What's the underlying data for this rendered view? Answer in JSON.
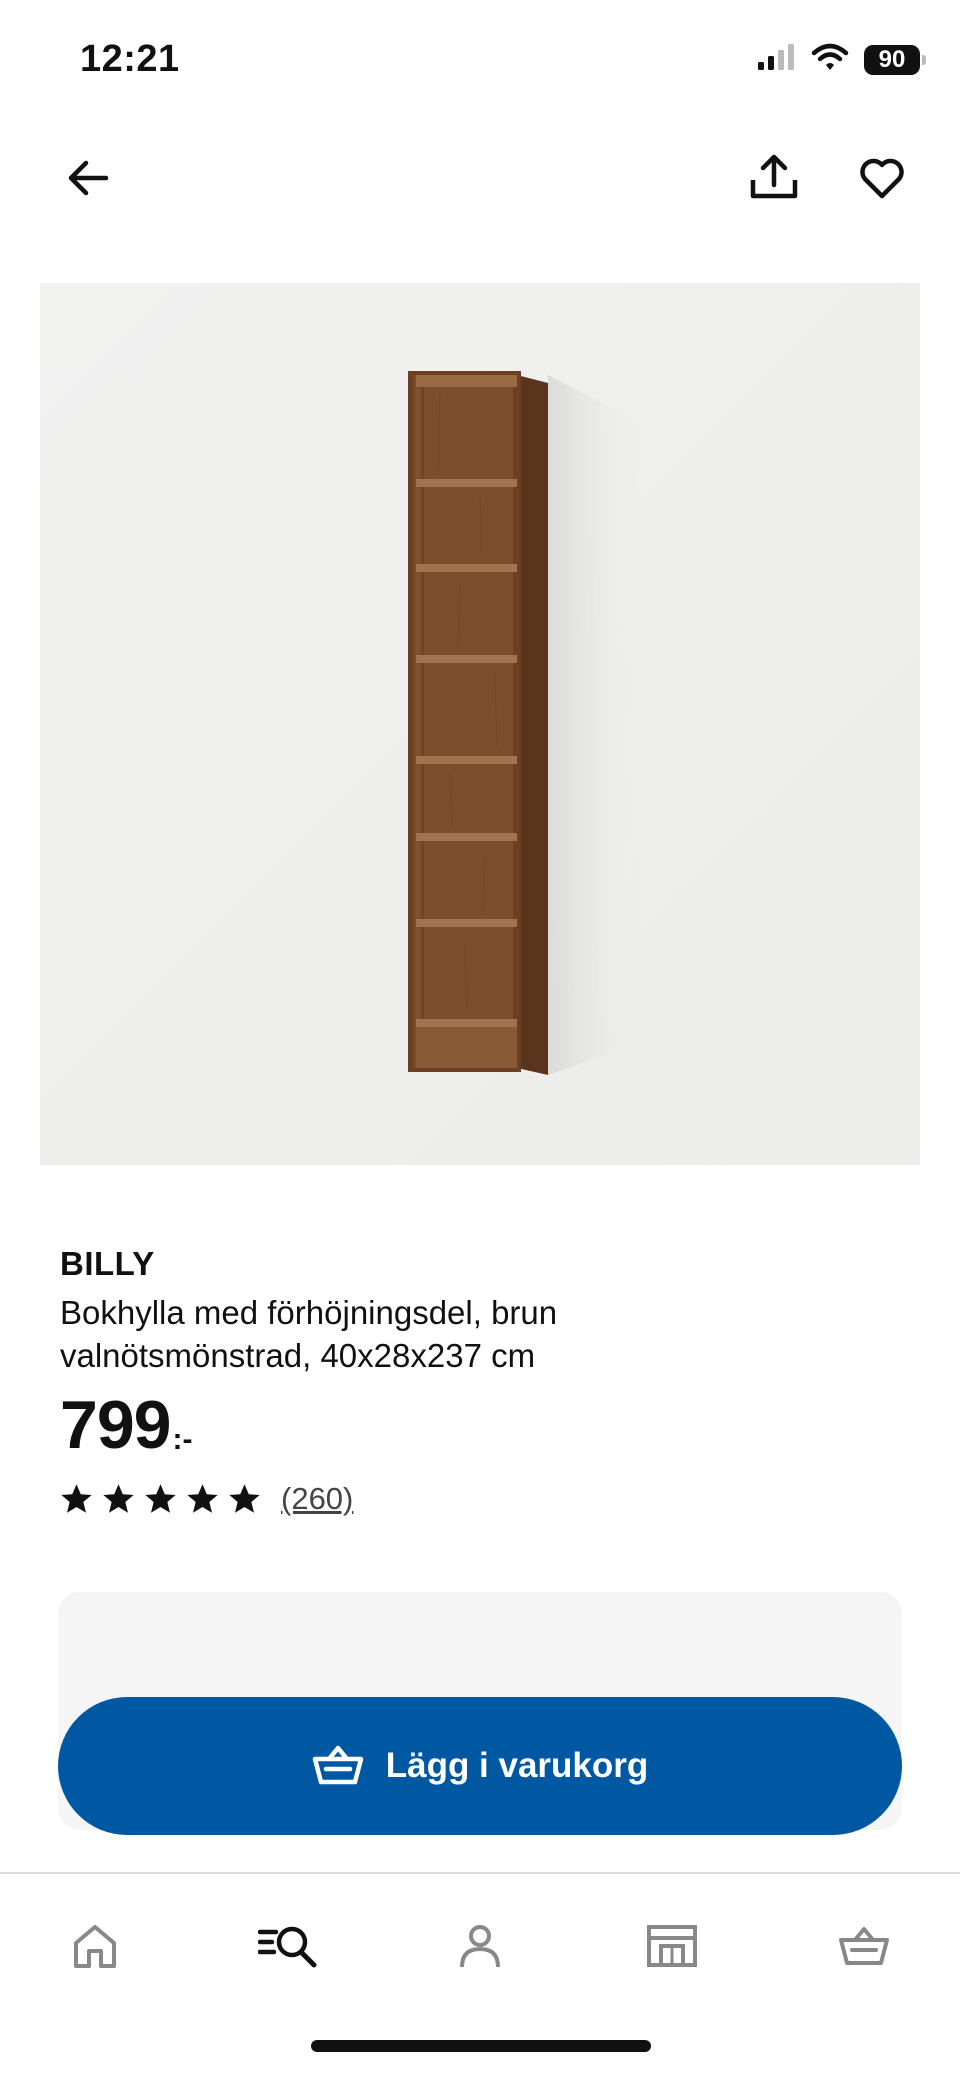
{
  "status_bar": {
    "time": "12:21",
    "battery": "90",
    "icons": [
      "signal-icon",
      "wifi-icon",
      "battery-icon"
    ]
  },
  "top_nav": {
    "icons": [
      "arrow-left-icon",
      "share-icon",
      "heart-icon"
    ]
  },
  "product": {
    "name": "BILLY",
    "description": "Bokhylla med förhöjningsdel, brun valnötsmönstrad, 40x28x237 cm",
    "price": "799",
    "price_suffix": ":-",
    "rating": 5,
    "rating_max": 5,
    "review_count": "(260)"
  },
  "cta": {
    "label": "Lägg i varukorg",
    "icon": "basket-icon",
    "color": "#0058a3"
  },
  "tab_bar": {
    "tabs": [
      "home-icon",
      "search-icon",
      "profile-icon",
      "store-icon",
      "basket-icon"
    ]
  },
  "colors": {
    "accent": "#0058a3",
    "image_background": "#efefef",
    "card_background": "#f5f5f5"
  }
}
